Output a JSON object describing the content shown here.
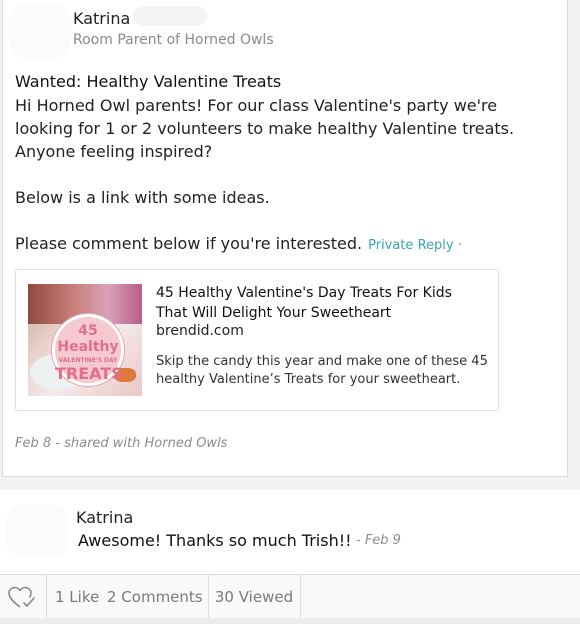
{
  "post": {
    "author_name": "Katrina",
    "author_role": "Room Parent of Horned Owls",
    "title": "Wanted: Healthy Valentine Treats",
    "body_para1": "Hi Horned Owl parents! For our class Valentine's party we're looking for 1 or 2 volunteers to make healthy Valentine treats. Anyone feeling inspired?",
    "body_para2": "Below is a link with some ideas.",
    "body_para3": "Please comment below if you're interested.",
    "private_reply": "Private Reply ·",
    "meta": "Feb 8 - shared with Horned Owls"
  },
  "link_preview": {
    "title": "45 Healthy Valentine's Day Treats For Kids That Will Delight Your Sweetheart",
    "domain": "brendid.com",
    "description": "Skip the candy this year and make one of these 45 healthy Valentine’s Treats for your sweetheart.",
    "thumb_badge_line1": "45 Healthy",
    "thumb_badge_line2": "VALENTINE'S DAY",
    "thumb_badge_line3": "TREATS"
  },
  "comment": {
    "author_name": "Katrina",
    "text": "Awesome!  Thanks so much Trish!!",
    "date": "- Feb 9"
  },
  "footer": {
    "likes": "1 Like",
    "comments": "2 Comments",
    "viewed": "30 Viewed",
    "like_icon": "heart-icon"
  },
  "colors": {
    "accent": "#3aa3b8",
    "meta_gray": "#8c8c8c"
  }
}
